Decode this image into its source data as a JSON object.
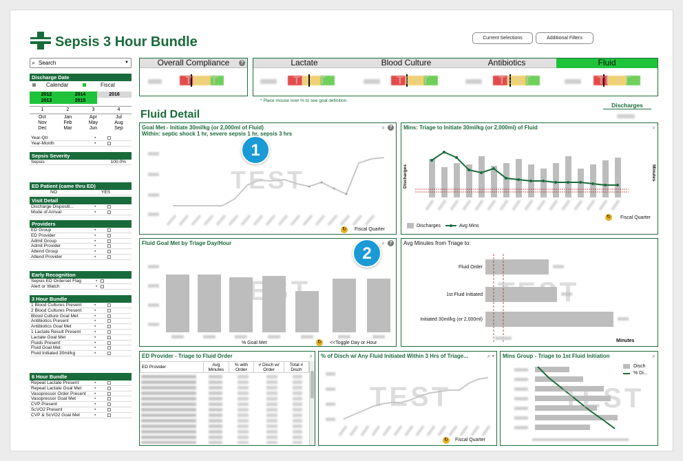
{
  "app_title": "Sepsis 3 Hour Bundle",
  "top_buttons": {
    "current": "Current Selections",
    "filters": "Additional Filters"
  },
  "search": {
    "placeholder": "Search"
  },
  "sidebar": {
    "discharge_date": "Discharge Date",
    "calendar": "Calendar",
    "fiscal": "Fiscal",
    "years": [
      "2012",
      "2014",
      "2016",
      "2013",
      "2015"
    ],
    "quarters": [
      "1",
      "2",
      "3",
      "4"
    ],
    "months": [
      [
        "Oct",
        "Nov",
        "Dec"
      ],
      [
        "Jan",
        "Feb",
        "Mar"
      ],
      [
        "Apr",
        "May",
        "Jun"
      ],
      [
        "Jul",
        "Aug",
        "Sep"
      ]
    ],
    "year_qtr": "Year-Qtr",
    "year_month": "Year-Month",
    "severity_header": "Sepsis Severity",
    "sepsis_label": "Sepsis",
    "sepsis_value": "100.0%",
    "ed_patient_header": "ED Patient (came thru ED)",
    "no": "NO",
    "yes": "YES",
    "visit_header": "Visit Detail",
    "visit_items": [
      "Discharge Dispositi...",
      "Mode of Arrival"
    ],
    "providers_header": "Providers",
    "provider_items": [
      "ED Group",
      "ED Provider",
      "Admit Group",
      "Admit Provider",
      "Attend Group",
      "Attend Provider"
    ],
    "early_header": "Early Recognition",
    "early_items": [
      "Sepsis ED Orderset Flag",
      "Alert or Watch"
    ],
    "bundle3_header": "3 Hour Bundle",
    "bundle3_items": [
      "1 Blood Cultures Present",
      "2 Blood Cultures Present",
      "Blood Culture Goal Met",
      "Antibiotics Present",
      "Antibiotics Goal Met",
      "1 Lactate Result Present",
      "Lactate Goal Met",
      "Fluids Present",
      "Fluid Goal Met",
      "Fluid Initiated 30ml/kg"
    ],
    "bundle6_header": "6 Hour Bundle",
    "bundle6_items": [
      "Repeat Lactate Present",
      "Repeat Lactate Goal Met",
      "Vasopressor Order Present",
      "Vasopressor Goal Met",
      "CVP Present",
      "ScVO2 Present",
      "CVP & ScVO2 Goal Met"
    ]
  },
  "kpi": {
    "overall": "Overall Compliance",
    "tabs": [
      "Lactate",
      "Blood Culture",
      "Antibiotics",
      "Fluid"
    ],
    "note": "* Place mouse over % to see goal definition.",
    "test": "TEST"
  },
  "section_title": "Fluid Detail",
  "discharges_link": "Discharges",
  "panels": {
    "p1_title": "Goal Met - Initiate 30ml/kg (or 2,000ml of Fluid)",
    "p1_sub": "Within: septic shock 1 hr, severe sepsis 1 hr, sepsis 3 hrs",
    "p1_x": "Fiscal Quarter",
    "p2_title": "Mins: Triage to Initiate 30ml/kg (or 2,000ml) of Fluid",
    "p2_y": "Discharges",
    "p2_y2": "Minutes",
    "p2_legend": [
      "Discharges",
      "Avg Mins"
    ],
    "p2_x": "Fiscal Quarter",
    "p3_title": "Fluid Goal Met by Triage Day/Hour",
    "p3_x": "% Goal Met",
    "p3_toggle": "<<Toggle Day or Hour",
    "p4_title": "Avg Minutes from Triage to:",
    "p4_labels": [
      "Fluid Order",
      "1st Fluid Initiated",
      "Initiated 30ml/kg (or 2,000ml)"
    ],
    "p4_x": "Minutes",
    "p5_title": "ED Provider - Triage to Fluid Order",
    "p5_cols": [
      "ED Provider",
      "Avg Minutes",
      "% with Order",
      "# Disch w/ Order",
      "Total # Disch"
    ],
    "p6_title": "% of Disch w/ Any Fluid Initiated Within 3 Hrs of Triage...",
    "p6_x": "Fiscal Quarter",
    "p7_title": "Mins Group - Triage to 1st Fluid Initiation",
    "p7_legend": [
      "Disch",
      "% Di..."
    ]
  },
  "markers": [
    "1",
    "2"
  ],
  "colors": {
    "brand": "#1a6b3c",
    "accent": "#1fc33a",
    "callout": "#1a9ad6"
  }
}
